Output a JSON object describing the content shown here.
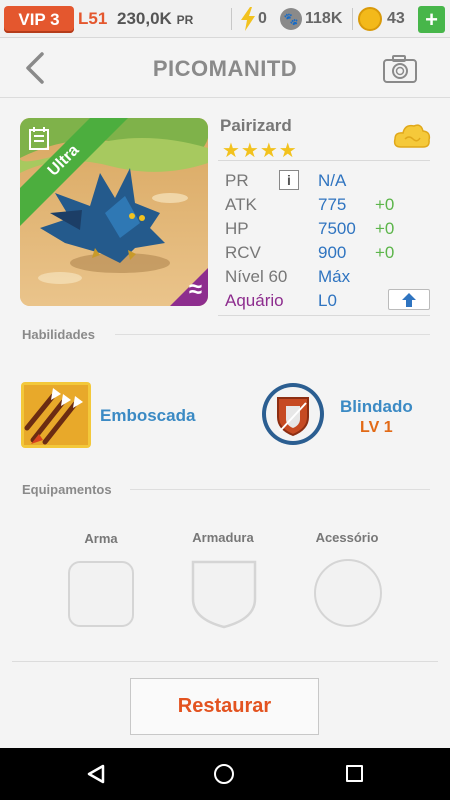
{
  "topbar": {
    "vip": "VIP 3",
    "level": "L51",
    "power_value": "230,0K",
    "power_unit": "PR",
    "energy": "0",
    "paw": "118K",
    "coins": "43",
    "add_label": "+"
  },
  "header": {
    "title": "PICOMANITD"
  },
  "monster": {
    "name": "Pairizard",
    "stars": "★★★★",
    "badge": "Ultra",
    "element_symbol": "≈",
    "stats": [
      {
        "label": "PR",
        "value": "N/A",
        "bonus": ""
      },
      {
        "label": "ATK",
        "value": "775",
        "bonus": "+0"
      },
      {
        "label": "HP",
        "value": "7500",
        "bonus": "+0"
      },
      {
        "label": "RCV",
        "value": "900",
        "bonus": "+0"
      }
    ],
    "level_label": "Nível 60",
    "level_value": "Máx",
    "aquarium_label": "Aquário",
    "aquarium_value": "L0"
  },
  "skills": {
    "section_label": "Habilidades",
    "items": [
      {
        "name": "Emboscada",
        "level": ""
      },
      {
        "name": "Blindado",
        "level": "LV 1"
      }
    ]
  },
  "equipment": {
    "section_label": "Equipamentos",
    "slots": [
      "Arma",
      "Armadura",
      "Acessório"
    ]
  },
  "actions": {
    "restore_label": "Restaurar"
  },
  "colors": {
    "accent_orange": "#e4572e",
    "stat_blue": "#2f74c0",
    "bonus_green": "#5cb54a",
    "aquarium_purple": "#8d2d8e",
    "star_yellow": "#f2c21e"
  }
}
